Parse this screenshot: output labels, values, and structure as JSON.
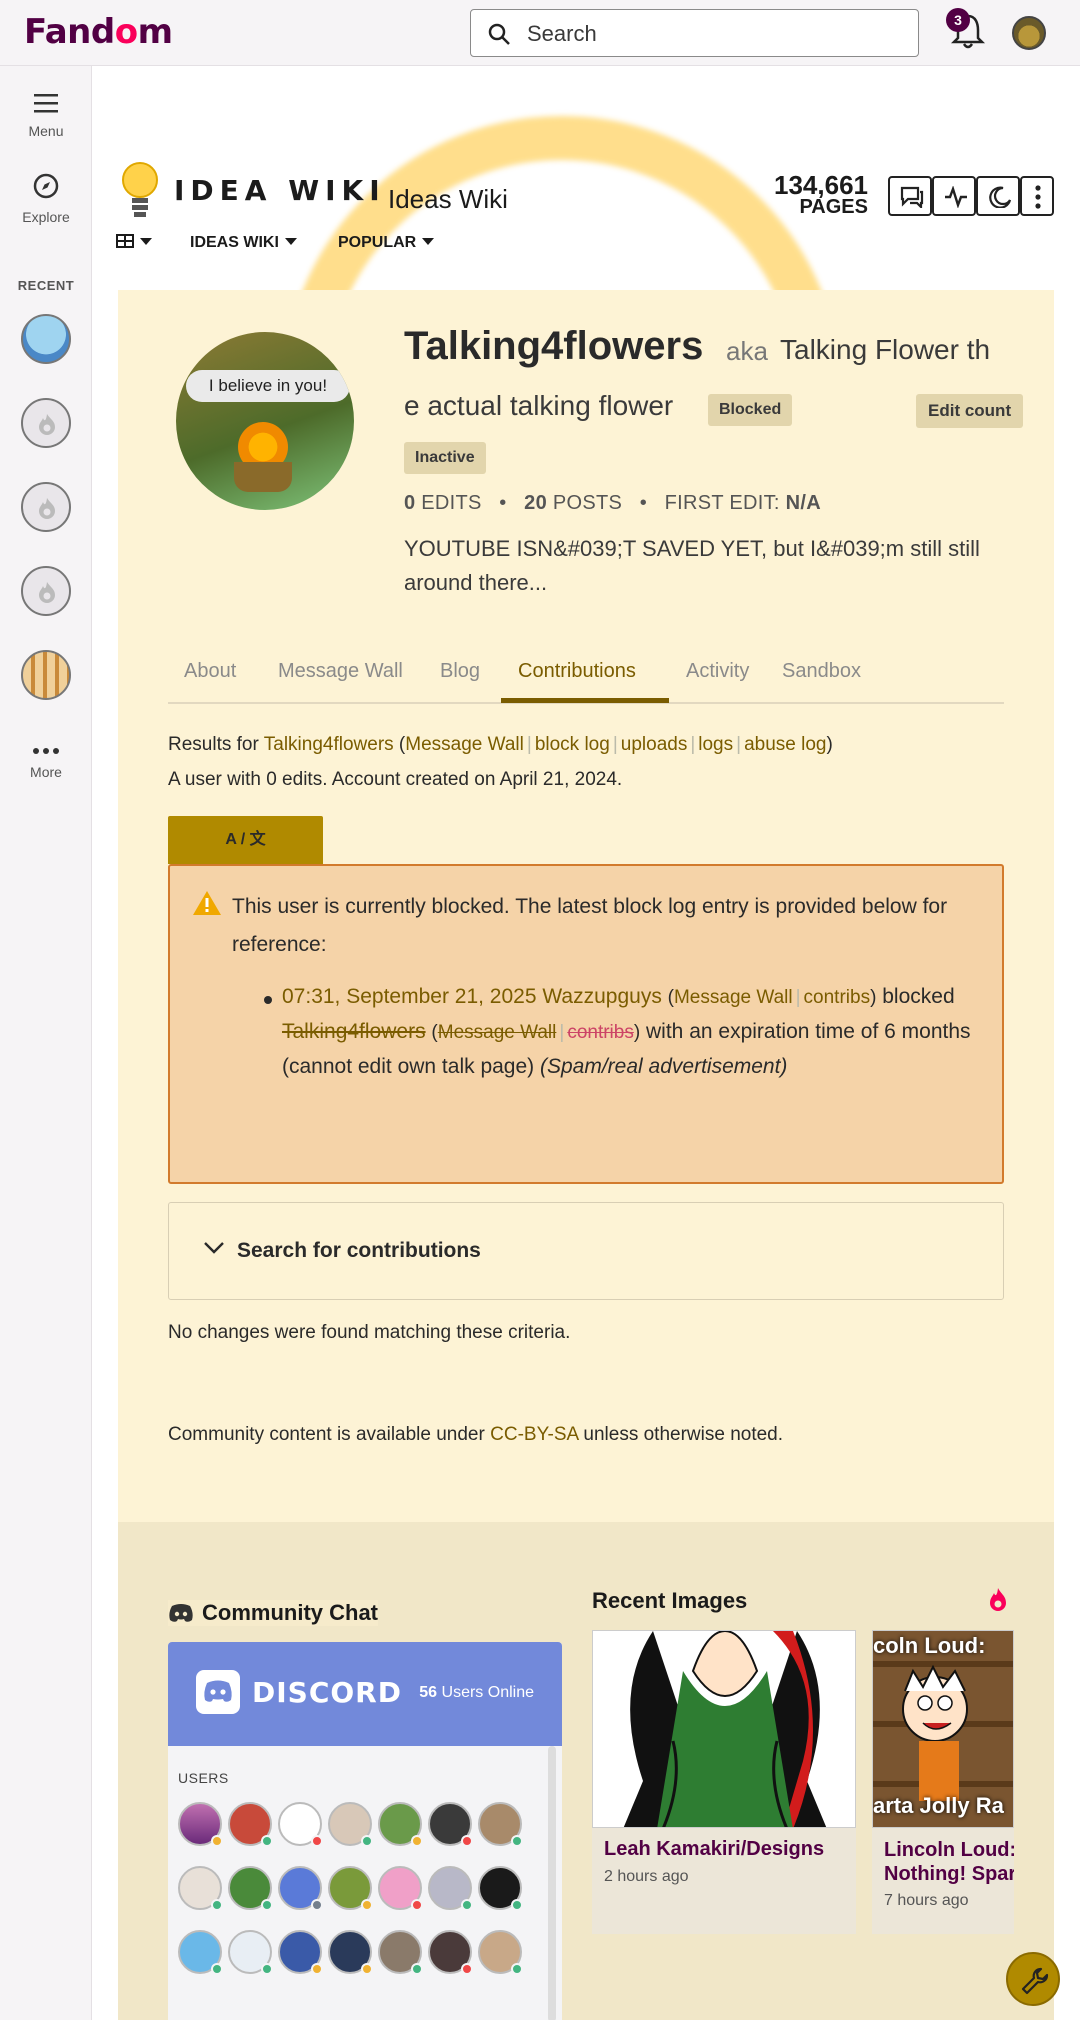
{
  "topbar": {
    "logo_prefix": "Fand",
    "logo_o": "o",
    "logo_suffix": "m",
    "search_placeholder": "Search",
    "notification_count": "3"
  },
  "rail": {
    "menu_label": "Menu",
    "explore_label": "Explore",
    "recent_label": "RECENT",
    "more_label": "More"
  },
  "wiki": {
    "wordmark": "IDEA WIKI",
    "name": "Ideas Wiki",
    "pages_count": "134,661",
    "pages_label": "PAGES",
    "nav": [
      "IDEAS WIKI",
      "POPULAR"
    ]
  },
  "profile": {
    "username": "Talking4flowers",
    "aka": "aka",
    "aka_name_line1": "Talking Flower th",
    "aka_name_line2": "e actual talking flower",
    "tag_blocked": "Blocked",
    "tag_inactive": "Inactive",
    "edit_count_button": "Edit count",
    "avatar_caption": "I believe in you!",
    "edits_num": "0",
    "edits_label": "EDITS",
    "posts_num": "20",
    "posts_label": "POSTS",
    "first_edit_label": "FIRST EDIT:",
    "first_edit_value": "N/A",
    "bio": "YOUTUBE ISN&#039;T SAVED YET, but I&#039;m still still around there..."
  },
  "tabs": [
    "About",
    "Message Wall",
    "Blog",
    "Contributions",
    "Activity",
    "Sandbox"
  ],
  "contributions": {
    "results_for": "Results for",
    "user_link": "Talking4flowers",
    "links": [
      "Message Wall",
      "block log",
      "uploads",
      "logs",
      "abuse log"
    ],
    "created_text": "A user with 0 edits. Account created on April 21, 2024.",
    "lang_button": "A / 文",
    "block_notice": "This user is currently blocked. The latest block log entry is provided below for reference:",
    "entry_time": "07:31, September 21, 2025",
    "entry_admin": "Wazzupguys",
    "entry_admin_links": [
      "Message Wall",
      "contribs"
    ],
    "entry_blocked": "blocked",
    "entry_target": "Talking4flowers",
    "entry_target_links": [
      "Message Wall",
      "contribs"
    ],
    "entry_expiry": "with an expiration time of 6 months (cannot edit own talk page)",
    "entry_reason": "(Spam/real advertisement)",
    "search_toggle": "Search for contributions",
    "no_changes": "No changes were found matching these criteria.",
    "license_pre": "Community content is available under",
    "license_link": "CC-BY-SA",
    "license_post": "unless otherwise noted."
  },
  "community_chat": {
    "title": "Community Chat",
    "discord_word": "DISCORD",
    "online_count": "56",
    "online_label": "Users Online",
    "users_label": "USERS"
  },
  "recent_images": {
    "title": "Recent Images",
    "items": [
      {
        "caption": "Leah Kamakiri/Designs",
        "time": "2 hours ago",
        "overlay": ""
      },
      {
        "caption": "Lincoln Loud: Nothing! Spar",
        "time": "7 hours ago",
        "overlay_top": "coln Loud:",
        "overlay_bottom": "arta Jolly Ra"
      }
    ]
  },
  "colors": {
    "brand": "#520044",
    "accent_pink": "#fa005a",
    "link_gold": "#7a5c00",
    "content_bg": "#fdf3d5",
    "discord": "#7289da"
  }
}
